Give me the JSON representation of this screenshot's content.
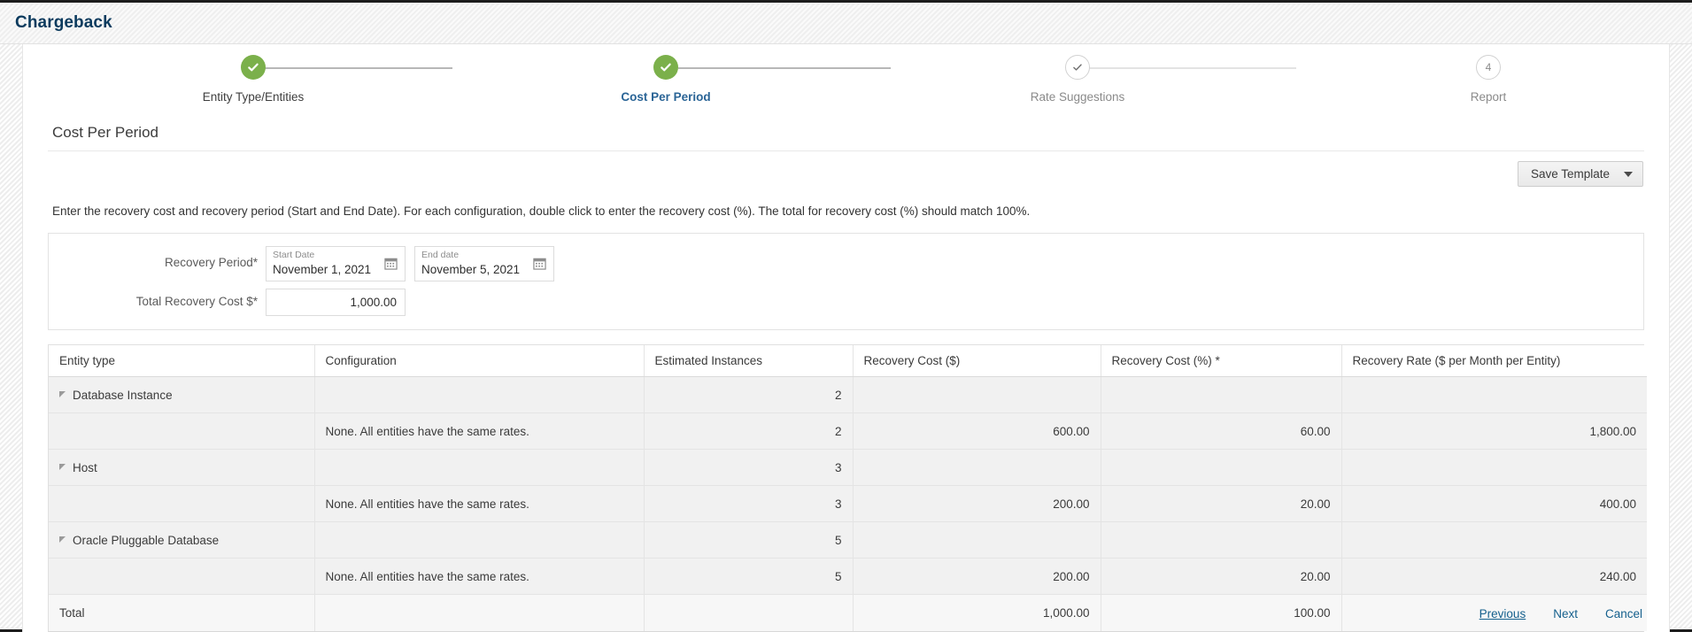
{
  "app": {
    "title": "Chargeback"
  },
  "stepper": {
    "steps": [
      {
        "label": "Entity Type/Entities",
        "state": "done",
        "marker": "check"
      },
      {
        "label": "Cost Per Period",
        "state": "current",
        "marker": "check"
      },
      {
        "label": "Rate Suggestions",
        "state": "pending",
        "marker": "check-outline"
      },
      {
        "label": "Report",
        "state": "pending",
        "marker": "4"
      }
    ]
  },
  "page": {
    "section_title": "Cost Per Period",
    "instructions": "Enter the recovery cost and recovery period (Start and End Date). For each configuration, double click to enter the recovery cost (%). The total for recovery cost (%) should match 100%."
  },
  "toolbar": {
    "save_template_label": "Save Template"
  },
  "form": {
    "recovery_period_label": "Recovery Period*",
    "start_date": {
      "label": "Start Date",
      "value": "November 1, 2021"
    },
    "end_date": {
      "label": "End date",
      "value": "November 5, 2021"
    },
    "total_recovery_cost_label": "Total Recovery Cost $*",
    "total_recovery_cost_value": "1,000.00"
  },
  "table": {
    "columns": [
      "Entity type",
      "Configuration",
      "Estimated Instances",
      "Recovery Cost ($)",
      "Recovery Cost (%) *",
      "Recovery Rate ($ per Month per Entity)"
    ],
    "rows": [
      {
        "kind": "group",
        "entity_type": "Database Instance",
        "configuration": "",
        "estimated_instances": "2",
        "recovery_cost_dollars": "",
        "recovery_cost_percent": "",
        "recovery_rate": ""
      },
      {
        "kind": "child",
        "entity_type": "",
        "configuration": "None. All entities have the same rates.",
        "estimated_instances": "2",
        "recovery_cost_dollars": "600.00",
        "recovery_cost_percent": "60.00",
        "recovery_rate": "1,800.00"
      },
      {
        "kind": "group",
        "entity_type": "Host",
        "configuration": "",
        "estimated_instances": "3",
        "recovery_cost_dollars": "",
        "recovery_cost_percent": "",
        "recovery_rate": ""
      },
      {
        "kind": "child",
        "entity_type": "",
        "configuration": "None. All entities have the same rates.",
        "estimated_instances": "3",
        "recovery_cost_dollars": "200.00",
        "recovery_cost_percent": "20.00",
        "recovery_rate": "400.00"
      },
      {
        "kind": "group",
        "entity_type": "Oracle Pluggable Database",
        "configuration": "",
        "estimated_instances": "5",
        "recovery_cost_dollars": "",
        "recovery_cost_percent": "",
        "recovery_rate": ""
      },
      {
        "kind": "child",
        "entity_type": "",
        "configuration": "None. All entities have the same rates.",
        "estimated_instances": "5",
        "recovery_cost_dollars": "200.00",
        "recovery_cost_percent": "20.00",
        "recovery_rate": "240.00"
      },
      {
        "kind": "total",
        "entity_type": "Total",
        "configuration": "",
        "estimated_instances": "",
        "recovery_cost_dollars": "1,000.00",
        "recovery_cost_percent": "100.00",
        "recovery_rate": ""
      }
    ]
  },
  "footer": {
    "previous_label": "Previous",
    "next_label": "Next",
    "cancel_label": "Cancel"
  },
  "colors": {
    "brand_dark_blue": "#0c3b5e",
    "step_done_green": "#7bb04b",
    "link_blue": "#15608d",
    "current_step_blue": "#2a6496"
  }
}
